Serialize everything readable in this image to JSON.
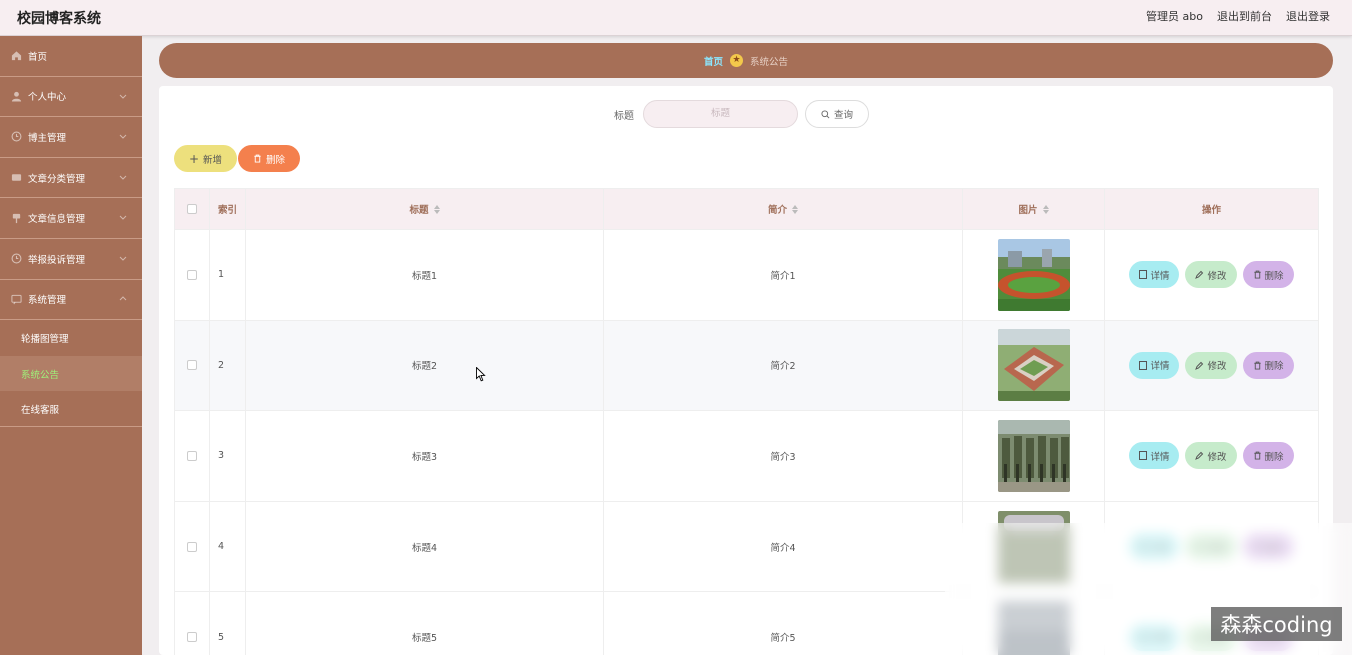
{
  "app": {
    "title": "校园博客系统"
  },
  "topnav": {
    "admin": "管理员 abo",
    "to_front": "退出到前台",
    "logout": "退出登录"
  },
  "sidebar": {
    "items": [
      {
        "label": "首页",
        "icon": "home-icon"
      },
      {
        "label": "个人中心",
        "icon": "user-icon"
      },
      {
        "label": "博主管理",
        "icon": "clock-icon"
      },
      {
        "label": "文章分类管理",
        "icon": "list-icon"
      },
      {
        "label": "文章信息管理",
        "icon": "pin-icon"
      },
      {
        "label": "举报投诉管理",
        "icon": "clock-icon"
      },
      {
        "label": "系统管理",
        "icon": "chat-icon"
      }
    ],
    "sub_items": [
      {
        "label": "轮播图管理"
      },
      {
        "label": "系统公告",
        "active": true
      },
      {
        "label": "在线客服"
      }
    ]
  },
  "breadcrumb": {
    "home": "首页",
    "current": "系统公告"
  },
  "search": {
    "label": "标题",
    "placeholder": "标题",
    "button": "查询"
  },
  "actions": {
    "add": "新增",
    "delete": "删除"
  },
  "table": {
    "headers": {
      "index": "索引",
      "title": "标题",
      "intro": "简介",
      "image": "图片",
      "ops": "操作"
    },
    "ops": {
      "detail": "详情",
      "edit": "修改",
      "delete": "删除"
    },
    "rows": [
      {
        "index": "1",
        "title": "标题1",
        "intro": "简介1"
      },
      {
        "index": "2",
        "title": "标题2",
        "intro": "简介2"
      },
      {
        "index": "3",
        "title": "标题3",
        "intro": "简介3"
      },
      {
        "index": "4",
        "title": "标题4",
        "intro": "简介4"
      },
      {
        "index": "5",
        "title": "标题5",
        "intro": "简介5"
      }
    ]
  },
  "watermark": "森森coding",
  "colors": {
    "sidebar": "#a66f57",
    "accent_green": "#9ff07a",
    "header_bg": "#f7eef1"
  }
}
